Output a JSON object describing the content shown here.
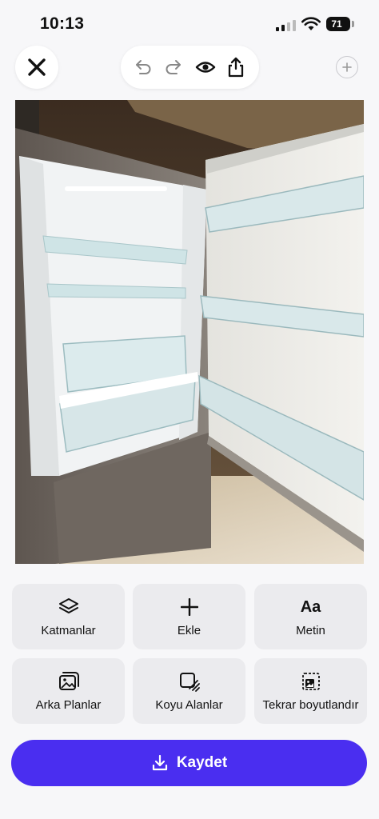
{
  "status_bar": {
    "time": "10:13",
    "battery": "71"
  },
  "top_bar": {
    "close_icon": "close-icon",
    "undo_icon": "undo-icon",
    "redo_icon": "redo-icon",
    "preview_icon": "eye-icon",
    "share_icon": "share-icon",
    "add_icon": "plus-circle-icon"
  },
  "tools": [
    {
      "label": "Katmanlar",
      "icon": "layers-icon"
    },
    {
      "label": "Ekle",
      "icon": "plus-icon"
    },
    {
      "label": "Metin",
      "icon": "text-icon",
      "icon_text": "Aa"
    },
    {
      "label": "Arka Planlar",
      "icon": "backgrounds-icon"
    },
    {
      "label": "Koyu Alanlar",
      "icon": "dark-areas-icon"
    },
    {
      "label": "Tekrar boyutlandır",
      "icon": "resize-icon"
    }
  ],
  "save_button": {
    "label": "Kaydet",
    "icon": "download-icon",
    "color": "#4a2ef0"
  }
}
